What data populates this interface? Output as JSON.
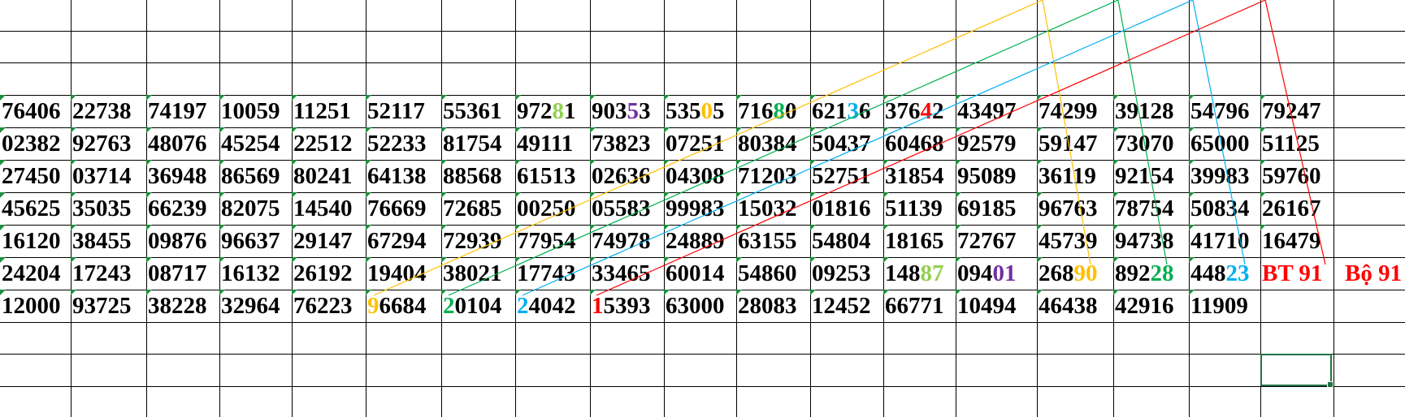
{
  "sheet": {
    "rows": [
      [
        "76406",
        "22738",
        "74197",
        "10059",
        "11251",
        "52117",
        "55361",
        "97281",
        "90353",
        "53505",
        "71680",
        "62136",
        "37642",
        "43497",
        "74299",
        "39128",
        "54796",
        "79247"
      ],
      [
        "02382",
        "92763",
        "48076",
        "45254",
        "22512",
        "52233",
        "81754",
        "49111",
        "73823",
        "07251",
        "80384",
        "50437",
        "60468",
        "92579",
        "59147",
        "73070",
        "65000",
        "51125"
      ],
      [
        "27450",
        "03714",
        "36948",
        "86569",
        "80241",
        "64138",
        "88568",
        "61513",
        "02636",
        "04308",
        "71203",
        "52751",
        "31854",
        "95089",
        "36119",
        "92154",
        "39983",
        "59760"
      ],
      [
        "45625",
        "35035",
        "66239",
        "82075",
        "14540",
        "76669",
        "72685",
        "00250",
        "05583",
        "99983",
        "15032",
        "01816",
        "51139",
        "69185",
        "96763",
        "78754",
        "50834",
        "26167"
      ],
      [
        "16120",
        "38455",
        "09876",
        "96637",
        "29147",
        "67294",
        "72939",
        "77954",
        "74978",
        "24889",
        "63155",
        "54804",
        "18165",
        "72767",
        "45739",
        "94738",
        "41710",
        "16479"
      ],
      [
        "24204",
        "17243",
        "08717",
        "16132",
        "26192",
        "19404",
        "38021",
        "17743",
        "33465",
        "60014",
        "54860",
        "09253",
        "14887",
        "09401",
        "26890",
        "89228",
        "44823",
        "BT 91",
        "Bộ 91"
      ],
      [
        "12000",
        "93725",
        "38228",
        "32964",
        "76223",
        "96684",
        "20104",
        "24042",
        "15393",
        "63000",
        "28083",
        "12452",
        "66771",
        "10494",
        "46438",
        "42916",
        "11909"
      ]
    ],
    "highlights": [
      {
        "row": 0,
        "col": 7,
        "pos": 3,
        "color": "#92d050"
      },
      {
        "row": 0,
        "col": 8,
        "pos": 3,
        "color": "#7030a0"
      },
      {
        "row": 0,
        "col": 9,
        "pos": 3,
        "color": "#ffc000"
      },
      {
        "row": 0,
        "col": 10,
        "pos": 3,
        "color": "#00b050"
      },
      {
        "row": 0,
        "col": 11,
        "pos": 3,
        "color": "#00b0f0"
      },
      {
        "row": 0,
        "col": 12,
        "pos": 3,
        "color": "#ff0000"
      },
      {
        "row": 5,
        "col": 12,
        "pos": 3,
        "color": "#92d050"
      },
      {
        "row": 5,
        "col": 12,
        "pos": 4,
        "color": "#92d050"
      },
      {
        "row": 5,
        "col": 13,
        "pos": 3,
        "color": "#7030a0"
      },
      {
        "row": 5,
        "col": 13,
        "pos": 4,
        "color": "#7030a0"
      },
      {
        "row": 5,
        "col": 14,
        "pos": 3,
        "color": "#ffc000"
      },
      {
        "row": 5,
        "col": 14,
        "pos": 4,
        "color": "#ffc000"
      },
      {
        "row": 5,
        "col": 15,
        "pos": 3,
        "color": "#00b050"
      },
      {
        "row": 5,
        "col": 15,
        "pos": 4,
        "color": "#00b050"
      },
      {
        "row": 5,
        "col": 16,
        "pos": 3,
        "color": "#00b0f0"
      },
      {
        "row": 5,
        "col": 16,
        "pos": 4,
        "color": "#00b0f0"
      },
      {
        "row": 6,
        "col": 5,
        "pos": 0,
        "color": "#ffc000"
      },
      {
        "row": 6,
        "col": 6,
        "pos": 0,
        "color": "#00b050"
      },
      {
        "row": 6,
        "col": 7,
        "pos": 0,
        "color": "#00b0f0"
      },
      {
        "row": 6,
        "col": 8,
        "pos": 0,
        "color": "#ff0000"
      }
    ],
    "red_labels": [
      "BT 91",
      "Bộ 91"
    ],
    "colors": {
      "yellow": "#ffc000",
      "green": "#00b050",
      "blue": "#00b0f0",
      "red": "#ff0000",
      "gridline": "#000000",
      "selection": "#217346",
      "error_indicator": "#1e8f3c"
    },
    "connector_lines": [
      {
        "color": "#ffc000",
        "from": "cell-top-yellow",
        "to": "row-6-col-5"
      },
      {
        "color": "#ffc000",
        "from": "cell-top-yellow",
        "to": "row-5-col-14"
      },
      {
        "color": "#00b050",
        "from": "cell-top-green",
        "to": "row-6-col-6"
      },
      {
        "color": "#00b050",
        "from": "cell-top-green",
        "to": "row-5-col-15"
      },
      {
        "color": "#00b0f0",
        "from": "cell-top-blue",
        "to": "row-6-col-7"
      },
      {
        "color": "#00b0f0",
        "from": "cell-top-blue",
        "to": "row-5-col-16"
      },
      {
        "color": "#ff0000",
        "from": "cell-top-red",
        "to": "row-6-col-8"
      },
      {
        "color": "#ff0000",
        "from": "cell-top-red",
        "to": "row-5-col-17"
      }
    ]
  }
}
